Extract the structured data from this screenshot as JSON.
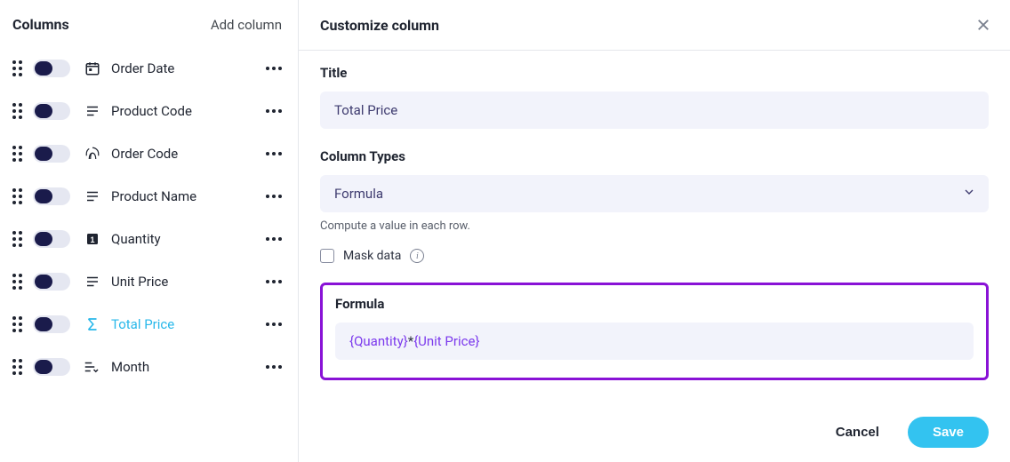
{
  "sidebar": {
    "title": "Columns",
    "add_label": "Add column",
    "items": [
      {
        "label": "Order Date",
        "icon": "calendar",
        "selected": false
      },
      {
        "label": "Product Code",
        "icon": "text",
        "selected": false
      },
      {
        "label": "Order Code",
        "icon": "fingerprint",
        "selected": false
      },
      {
        "label": "Product Name",
        "icon": "text",
        "selected": false
      },
      {
        "label": "Quantity",
        "icon": "number",
        "selected": false
      },
      {
        "label": "Unit Price",
        "icon": "text",
        "selected": false
      },
      {
        "label": "Total Price",
        "icon": "sigma",
        "selected": true
      },
      {
        "label": "Month",
        "icon": "sort",
        "selected": false
      }
    ]
  },
  "panel": {
    "heading": "Customize column",
    "title_label": "Title",
    "title_value": "Total Price",
    "types_label": "Column Types",
    "types_value": "Formula",
    "types_hint": "Compute a value in each row.",
    "mask_label": "Mask data",
    "mask_checked": false,
    "formula_label": "Formula",
    "formula_value": "{Quantity}*{Unit Price}",
    "formula_tokens": {
      "a": "{Quantity}",
      "op": "*",
      "b": "{Unit Price}"
    }
  },
  "footer": {
    "cancel_label": "Cancel",
    "save_label": "Save"
  }
}
